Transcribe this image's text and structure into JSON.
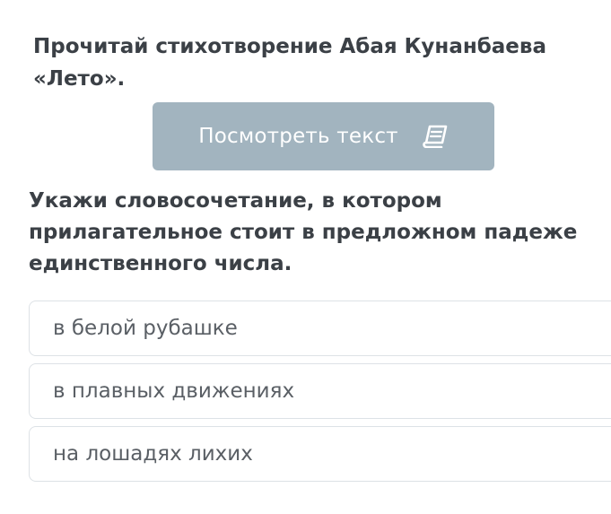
{
  "instruction": {
    "line1": "Прочитай стихотворение Абая Кунанбаева",
    "line2": "«Лето»."
  },
  "view_text_button": {
    "label": "Посмотреть текст",
    "icon": "book-icon",
    "color": "#a2b4bf"
  },
  "question": {
    "line1": "Укажи словосочетание, в котором",
    "line2": "прилагательное стоит в предложном падеже",
    "line3": "единственного числа."
  },
  "options": [
    {
      "label": "в белой рубашке"
    },
    {
      "label": "в плавных движениях"
    },
    {
      "label": "на лошадях лихих"
    }
  ],
  "colors": {
    "heading_text": "#3b4046",
    "option_text": "#5a5f65",
    "option_border": "#dde2e6"
  }
}
